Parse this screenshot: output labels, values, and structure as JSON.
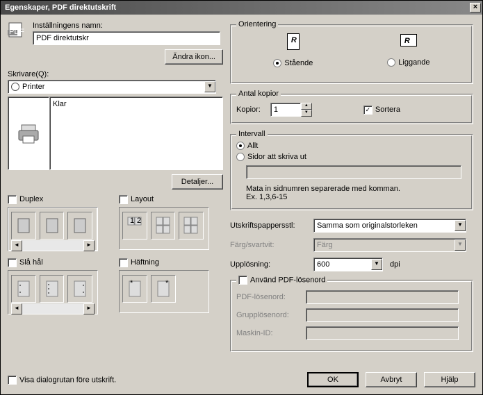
{
  "window": {
    "title": "Egenskaper, PDF direktutskrift"
  },
  "settings": {
    "name_label": "Inställningens namn:",
    "name_value": "PDF direktutskr",
    "change_icon_btn": "Ändra ikon..."
  },
  "printer": {
    "label": "Skrivare(Q):",
    "selected": "Printer",
    "status": "Klar",
    "details_btn": "Detaljer..."
  },
  "options": {
    "duplex_label": "Duplex",
    "layout_label": "Layout",
    "punch_label": "Slå hål",
    "staple_label": "Häftning"
  },
  "orientation": {
    "legend": "Orientering",
    "portrait": "Stående",
    "landscape": "Liggande"
  },
  "copies": {
    "legend": "Antal kopior",
    "copies_label": "Kopior:",
    "copies_value": "1",
    "sort_label": "Sortera"
  },
  "range": {
    "legend": "Intervall",
    "all": "Allt",
    "pages": "Sidor att skriva ut",
    "hint1": "Mata in sidnumren separerade med komman.",
    "hint2": "Ex. 1,3,6-15"
  },
  "output": {
    "paper_label": "Utskriftspappersstl:",
    "paper_value": "Samma som originalstorleken",
    "color_label": "Färg/svartvit:",
    "color_value": "Färg",
    "resolution_label": "Upplösning:",
    "resolution_value": "600",
    "dpi": "dpi"
  },
  "pdf": {
    "use_password_label": "Använd PDF-lösenord",
    "pdf_password": "PDF-lösenord:",
    "group_password": "Grupplösenord:",
    "machine_id": "Maskin-ID:"
  },
  "bottom": {
    "show_dialog": "Visa dialogrutan före utskrift.",
    "ok": "OK",
    "cancel": "Avbryt",
    "help": "Hjälp"
  }
}
